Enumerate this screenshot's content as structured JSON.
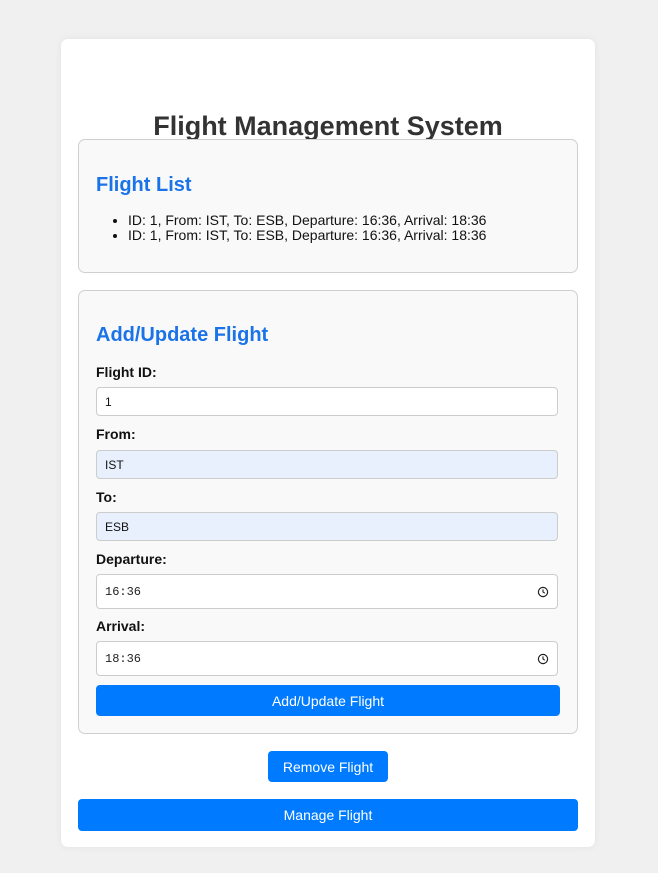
{
  "page": {
    "title": "Flight Management System"
  },
  "flight_list": {
    "heading": "Flight List",
    "items": [
      "ID: 1, From: IST, To: ESB, Departure: 16:36, Arrival: 18:36",
      "ID: 1, From: IST, To: ESB, Departure: 16:36, Arrival: 18:36"
    ]
  },
  "form": {
    "heading": "Add/Update Flight",
    "flight_id": {
      "label": "Flight ID:",
      "value": "1"
    },
    "from": {
      "label": "From:",
      "value": "IST"
    },
    "to": {
      "label": "To:",
      "value": "ESB"
    },
    "departure": {
      "label": "Departure:",
      "value": "16:36"
    },
    "arrival": {
      "label": "Arrival:",
      "value": "18:36"
    },
    "submit_label": "Add/Update Flight"
  },
  "actions": {
    "remove_label": "Remove Flight",
    "manage_label": "Manage Flight"
  },
  "colors": {
    "accent": "#007bff",
    "heading": "#1a73e8",
    "autofill_bg": "#e8f0fe",
    "page_bg": "#f0f0f0"
  },
  "icons": {
    "time_field": "clock-icon"
  }
}
